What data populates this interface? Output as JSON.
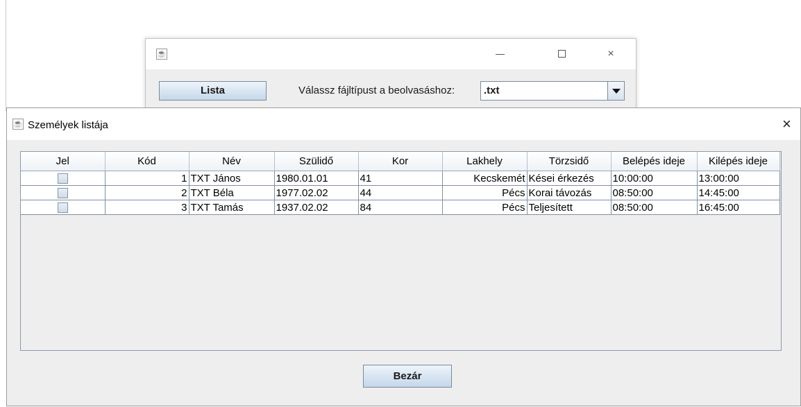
{
  "main_window": {
    "title": "",
    "icon": "java-icon",
    "controls": {
      "minimize": "minimize-icon",
      "maximize": "maximize-icon",
      "close": "×"
    },
    "lista_button": "Lista",
    "filetype_label": "Válassz fájltípust a beolvasáshoz:",
    "filetype_selected": ".txt"
  },
  "dialog": {
    "title": "Személyek listája",
    "icon": "java-icon",
    "close": "×",
    "columns": [
      "Jel",
      "Kód",
      "Név",
      "Szülidő",
      "Kor",
      "Lakhely",
      "Törzsidő",
      "Belépés ideje",
      "Kilépés ideje"
    ],
    "rows": [
      {
        "jel": false,
        "kod": "1",
        "nev": "TXT János",
        "szulido": "1980.01.01",
        "kor": "41",
        "lakhely": "Kecskemét",
        "torzsido": "Kései érkezés",
        "belepes": "10:00:00",
        "kilepes": "13:00:00"
      },
      {
        "jel": false,
        "kod": "2",
        "nev": "TXT Béla",
        "szulido": "1977.02.02",
        "kor": "44",
        "lakhely": "Pécs",
        "torzsido": "Korai távozás",
        "belepes": "08:50:00",
        "kilepes": "14:45:00"
      },
      {
        "jel": false,
        "kod": "3",
        "nev": "TXT Tamás",
        "szulido": "1937.02.02",
        "kor": "84",
        "lakhely": "Pécs",
        "torzsido": "Teljesített",
        "belepes": "08:50:00",
        "kilepes": "16:45:00"
      }
    ],
    "bezar_button": "Bezár"
  }
}
